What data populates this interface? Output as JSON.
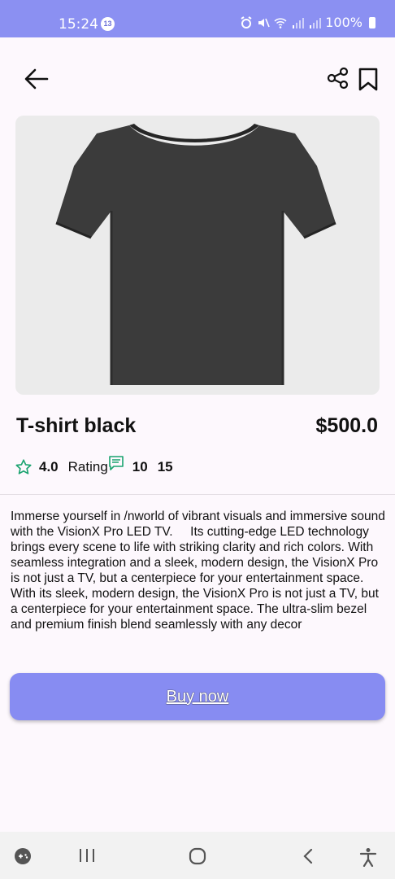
{
  "status_bar": {
    "time": "15:24",
    "notification_count": "13",
    "battery": "100%"
  },
  "product": {
    "title": "T-shirt black",
    "price": "$500.0",
    "rating": "4.0",
    "rating_label": "Rating",
    "count_a": "10",
    "count_b": "15",
    "description": "Immerse yourself in /nworld of vibrant visuals and immersive sound with the VisionX Pro LED TV.     Its cutting-edge LED technology brings every scene to life with striking clarity and rich colors. With seamless integration and a sleek, modern design, the VisionX Pro is not just a TV, but a centerpiece for your entertainment space.     With its sleek, modern design, the VisionX Pro is not just a TV, but a centerpiece for your entertainment space. The ultra-slim bezel and premium finish blend seamlessly with any decor"
  },
  "actions": {
    "buy_label": "Buy now"
  },
  "colors": {
    "accent": "#878cf2",
    "status_bar": "#8b90f2",
    "background": "#fdf8fd",
    "star": "#1aa36f",
    "image_bg": "#ebebeb"
  }
}
